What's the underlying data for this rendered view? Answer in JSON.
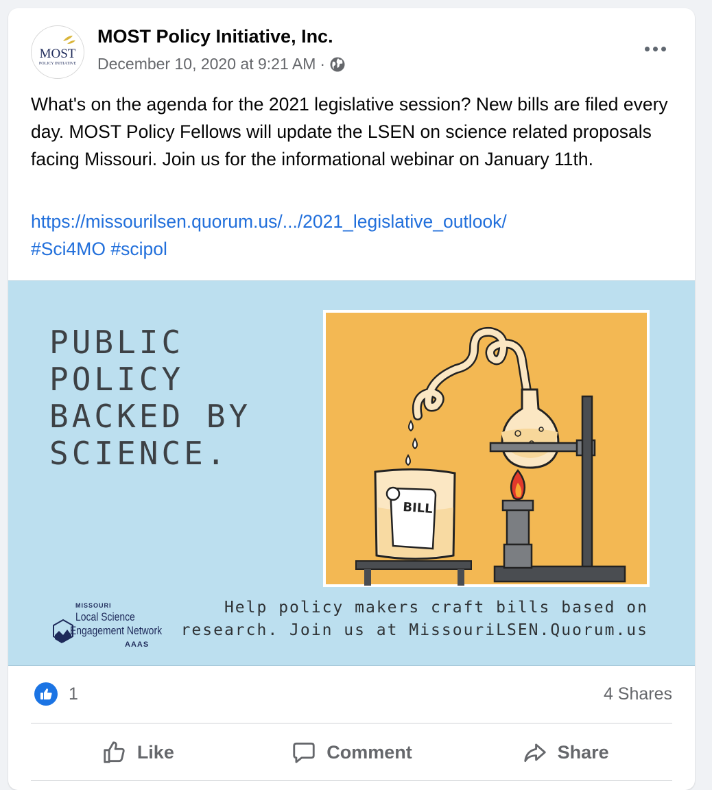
{
  "post": {
    "page_name": "MOST Policy Initiative, Inc.",
    "timestamp": "December 10, 2020 at 9:21 AM",
    "separator": "·",
    "privacy_icon": "globe-icon",
    "body": "What's on the agenda for the 2021 legislative session? New bills are filed every day. MOST Policy Fellows will update the LSEN on science related proposals facing Missouri. Join us for the informational webinar on January 11th.",
    "link_text": "https://missourilsen.quorum.us/.../2021_legislative_outlook/",
    "hashtags": [
      "#Sci4MO",
      "#scipol"
    ]
  },
  "avatar": {
    "logo_text": "MOST",
    "logo_subtext": "POLICY INITIATIVE"
  },
  "image": {
    "headline": [
      "PUBLIC",
      "POLICY",
      "BACKED BY",
      "SCIENCE."
    ],
    "caption_line1": "Help policy makers craft bills based on",
    "caption_line2": "research. Join us at MissouriLSEN.Quorum.us",
    "bill_label": "BILL",
    "logo_state": "MISSOURI",
    "logo_line1": "Local Science",
    "logo_line2": "Engagement Network",
    "logo_aaas": "AAAS",
    "colors": {
      "background": "#bcdfef",
      "panel": "#f3b853"
    }
  },
  "stats": {
    "like_count": "1",
    "shares": "4 Shares"
  },
  "actions": {
    "like": "Like",
    "comment": "Comment",
    "share": "Share"
  },
  "colors": {
    "link": "#216fdb",
    "like_blue": "#1b74e4",
    "secondary_text": "#65676b"
  }
}
